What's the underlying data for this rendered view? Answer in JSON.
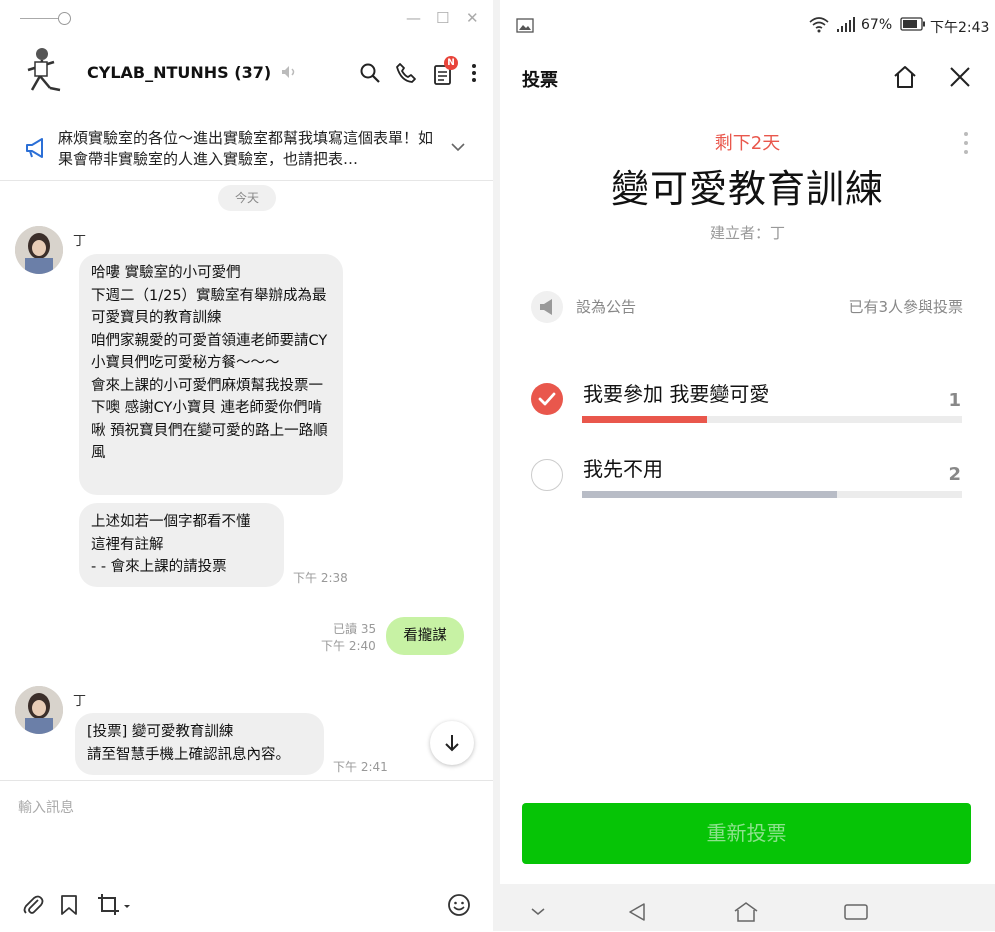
{
  "chat": {
    "title": "CYLAB_NTUNHS (37)",
    "notice_text": "麻煩實驗室的各位～進出實驗室都幫我填寫這個表單！如果會帶非實驗室的人進入實驗室，也請把表…",
    "date_label": "今天",
    "messages": [
      {
        "sender": "丁",
        "text": "哈嘍 實驗室的小可愛們\n下週二（1/25）實驗室有舉辦成為最可愛寶貝的教育訓練\n咱們家親愛的可愛首領連老師要請CY小寶貝們吃可愛秘方餐～～～\n會來上課的小可愛們麻煩幫我投票一下噢 感謝CY小寶貝 連老師愛你們啃啾 預祝寶貝們在變可愛的路上一路順風"
      },
      {
        "text": "上述如若一個字都看不懂\n這裡有註解\n- - 會來上課的請投票",
        "time": "下午 2:38"
      },
      {
        "text": "看攏謀",
        "read": "已讀 35",
        "time": "下午 2:40"
      },
      {
        "sender": "丁",
        "text": "[投票] 變可愛教育訓練\n請至智慧手機上確認訊息內容。",
        "time": "下午 2:41"
      }
    ],
    "input_placeholder": "輸入訊息",
    "notification_badge": "N"
  },
  "phone": {
    "battery": "67%",
    "time": "下午2:43",
    "header_title": "投票",
    "remaining": "剩下2天",
    "poll_title": "變可愛教育訓練",
    "creator": "建立者：丁",
    "set_notice_label": "設為公告",
    "participants": "已有3人參與投票",
    "options": [
      {
        "label": "我要參加 我要變可愛",
        "count": "1",
        "selected": true,
        "fraction": 0.33,
        "bar_color": "#e9574c"
      },
      {
        "label": "我先不用",
        "count": "2",
        "selected": false,
        "fraction": 0.67,
        "bar_color": "#b8bcc6"
      }
    ],
    "revote_label": "重新投票",
    "accent_green": "#06c406",
    "accent_red": "#e9574c"
  }
}
